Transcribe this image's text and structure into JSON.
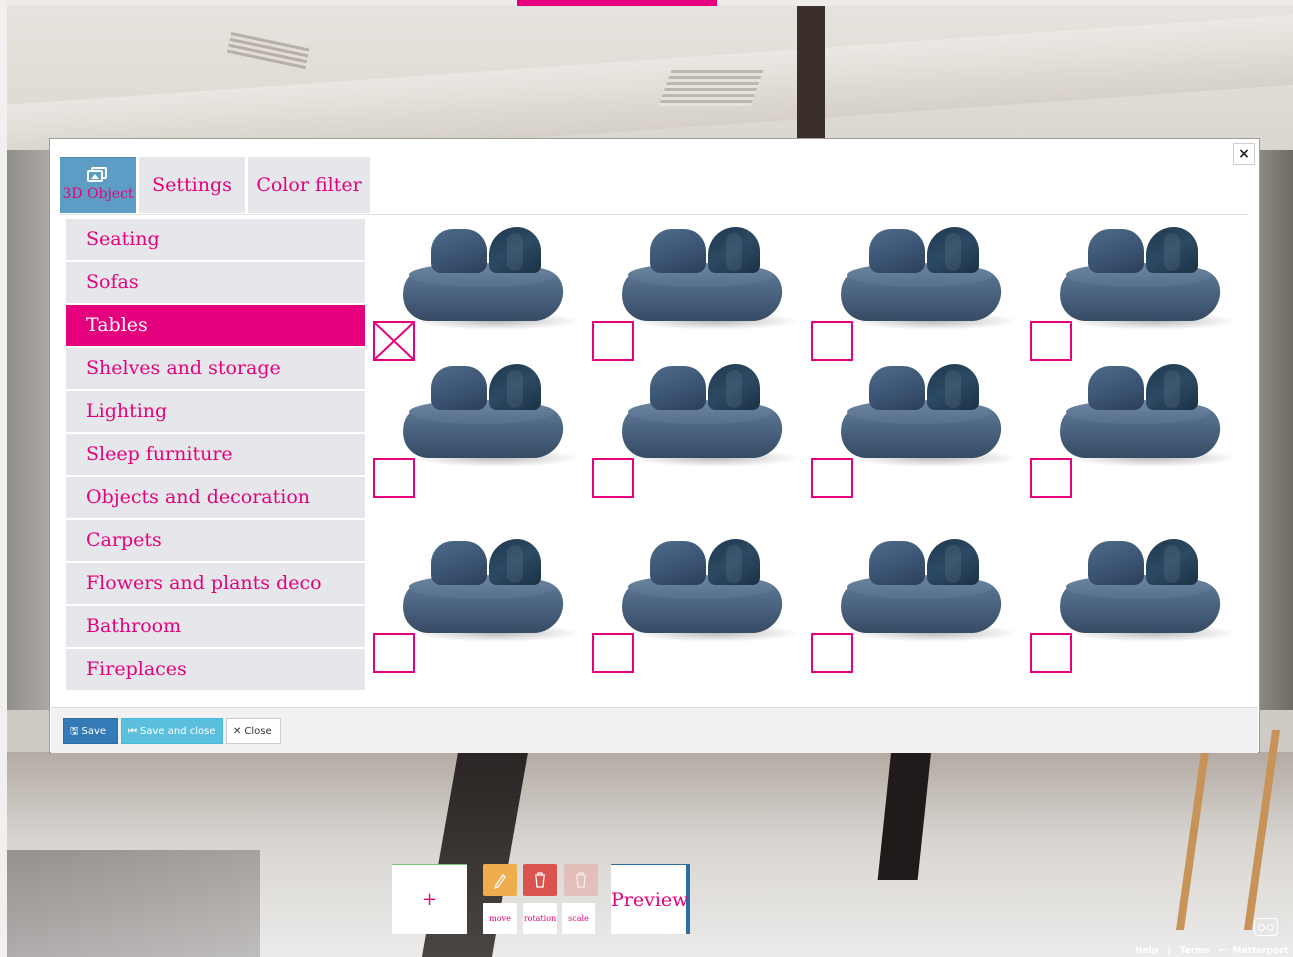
{
  "modal": {
    "close_symbol": "×",
    "tabs": [
      {
        "label": "3D Object",
        "active": true,
        "icon": "images-icon"
      },
      {
        "label": "Settings",
        "active": false
      },
      {
        "label": "Color filter",
        "active": false
      }
    ],
    "categories": [
      {
        "label": "Seating",
        "active": false
      },
      {
        "label": "Sofas",
        "active": false
      },
      {
        "label": "Tables",
        "active": true
      },
      {
        "label": "Shelves and storage",
        "active": false
      },
      {
        "label": "Lighting",
        "active": false
      },
      {
        "label": "Sleep furniture",
        "active": false
      },
      {
        "label": "Objects and decoration",
        "active": false
      },
      {
        "label": "Carpets",
        "active": false
      },
      {
        "label": "Flowers and plants deco",
        "active": false
      },
      {
        "label": "Bathroom",
        "active": false
      },
      {
        "label": "Fireplaces",
        "active": false
      }
    ],
    "items": [
      {
        "thumbnail": "blue-sofa",
        "checked": true
      },
      {
        "thumbnail": "blue-sofa",
        "checked": false
      },
      {
        "thumbnail": "blue-sofa",
        "checked": false
      },
      {
        "thumbnail": "blue-sofa",
        "checked": false
      },
      {
        "thumbnail": "blue-sofa",
        "checked": false
      },
      {
        "thumbnail": "blue-sofa",
        "checked": false
      },
      {
        "thumbnail": "blue-sofa",
        "checked": false
      },
      {
        "thumbnail": "blue-sofa",
        "checked": false
      },
      {
        "thumbnail": "blue-sofa",
        "checked": false
      },
      {
        "thumbnail": "blue-sofa",
        "checked": false
      },
      {
        "thumbnail": "blue-sofa",
        "checked": false
      },
      {
        "thumbnail": "blue-sofa",
        "checked": false
      }
    ],
    "footer": {
      "save_label": "Save",
      "save_and_close_label": "Save and close",
      "close_label": "Close"
    }
  },
  "toolbar": {
    "add_label": "+",
    "move_label": "move",
    "rotation_label": "rotation",
    "scale_label": "scale",
    "preview_label": "Preview"
  },
  "viewer_footer": {
    "help": "Help",
    "separator": "|",
    "terms": "Terms",
    "brand": "Matterport"
  },
  "colors": {
    "accent": "#e5007e",
    "tab_active": "#5d9dc5",
    "tab_bg": "#e6e7ea",
    "save": "#337ab7",
    "save_close": "#5bc0de",
    "edit": "#f0ad4e",
    "delete": "#d9534f"
  }
}
